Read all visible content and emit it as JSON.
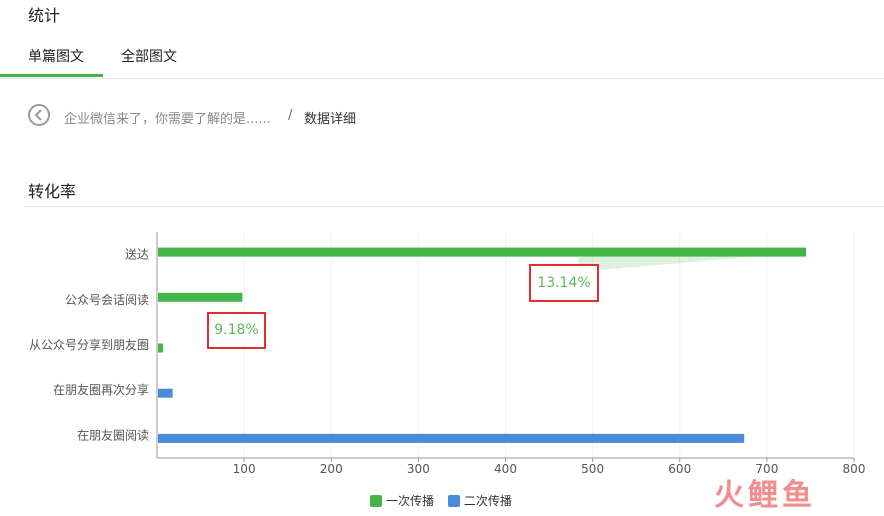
{
  "header": {
    "title": "统计"
  },
  "tabs": [
    {
      "label": "单篇图文"
    },
    {
      "label": "全部图文"
    }
  ],
  "breadcrumb": {
    "article": "企业微信来了，你需要了解的是......",
    "separator": "/",
    "current": "数据详细"
  },
  "section": {
    "title": "转化率"
  },
  "callouts": [
    "13.14%",
    "9.18%"
  ],
  "watermark": "火鲤鱼",
  "colors": {
    "accent": "#44b549",
    "series1": "#44b549",
    "series2": "#4a8bdc",
    "callout_border": "#e02f2f",
    "callout_text": "#5cb85c"
  },
  "chart_data": {
    "type": "bar",
    "orientation": "horizontal",
    "categories": [
      "送达",
      "公众号会话阅读",
      "从公众号分享到朋友圈",
      "在朋友圈再次分享",
      "在朋友圈阅读"
    ],
    "series": [
      {
        "name": "一次传播",
        "values": [
          745,
          98,
          7,
          null,
          null
        ]
      },
      {
        "name": "二次传播",
        "values": [
          null,
          null,
          null,
          18,
          674
        ]
      }
    ],
    "xlim": [
      0,
      800
    ],
    "xticks": [
      100,
      200,
      300,
      400,
      500,
      600,
      700,
      800
    ],
    "grid": true,
    "legend_position": "bottom"
  }
}
